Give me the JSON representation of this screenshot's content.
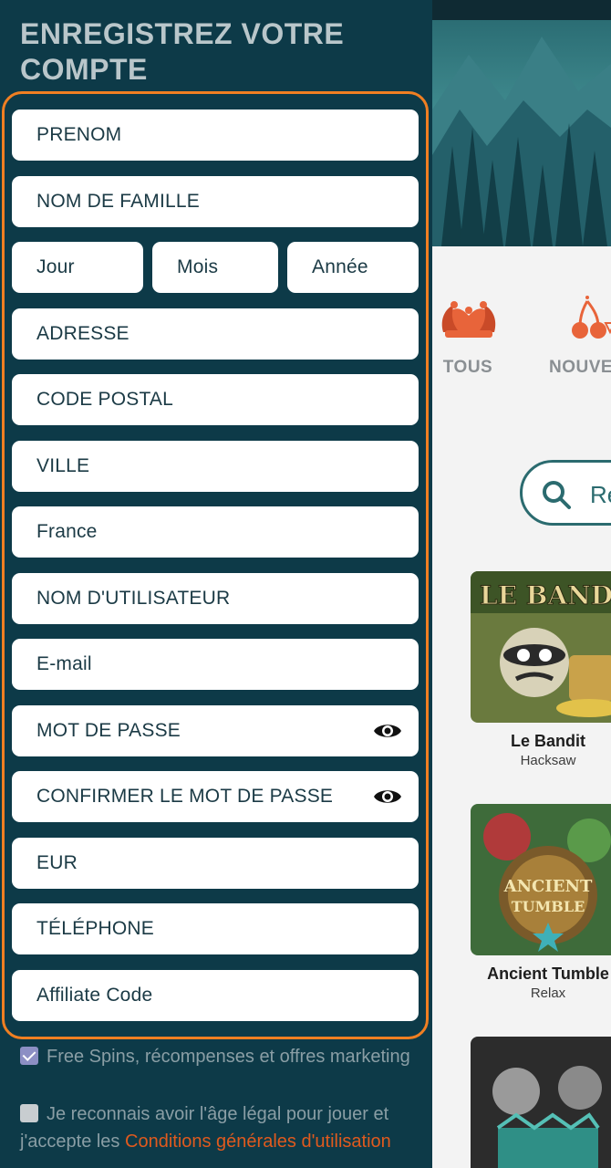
{
  "drawer": {
    "title": "ENREGISTREZ VOTRE COMPTE"
  },
  "form": {
    "first_name_placeholder": "PRENOM",
    "last_name_placeholder": "NOM DE FAMILLE",
    "day_placeholder": "Jour",
    "month_placeholder": "Mois",
    "year_placeholder": "Année",
    "address_placeholder": "ADRESSE",
    "postal_code_placeholder": "CODE POSTAL",
    "city_placeholder": "VILLE",
    "country_value": "France",
    "username_placeholder": "NOM D'UTILISATEUR",
    "email_placeholder": "E-mail",
    "password_placeholder": "MOT DE PASSE",
    "confirm_password_placeholder": "CONFIRMER LE MOT DE PASSE",
    "currency_value": "EUR",
    "phone_placeholder": "TÉLÉPHONE",
    "affiliate_placeholder": "Affiliate Code"
  },
  "consents": {
    "marketing_label": "Free Spins, récompenses et offres marketing",
    "marketing_checked": true,
    "age_label_prefix": "Je reconnais avoir l'âge légal pour jouer et j'accepte les ",
    "age_link": "Conditions générales d'utilisation",
    "age_checked": false
  },
  "background": {
    "categories": [
      {
        "label": "TOUS",
        "icon": "jester-hat-icon"
      },
      {
        "label": "NOUVE",
        "icon": "cherries-icon"
      }
    ],
    "search_text": "Re",
    "games": [
      {
        "name": "Le Bandit",
        "provider": "Hacksaw"
      },
      {
        "name": "Ancient Tumble",
        "provider": "Relax"
      }
    ]
  },
  "colors": {
    "drawer_bg": "#0d3a48",
    "form_border": "#f07f22",
    "link": "#e05a1e",
    "accent_teal": "#2b6b6f"
  }
}
